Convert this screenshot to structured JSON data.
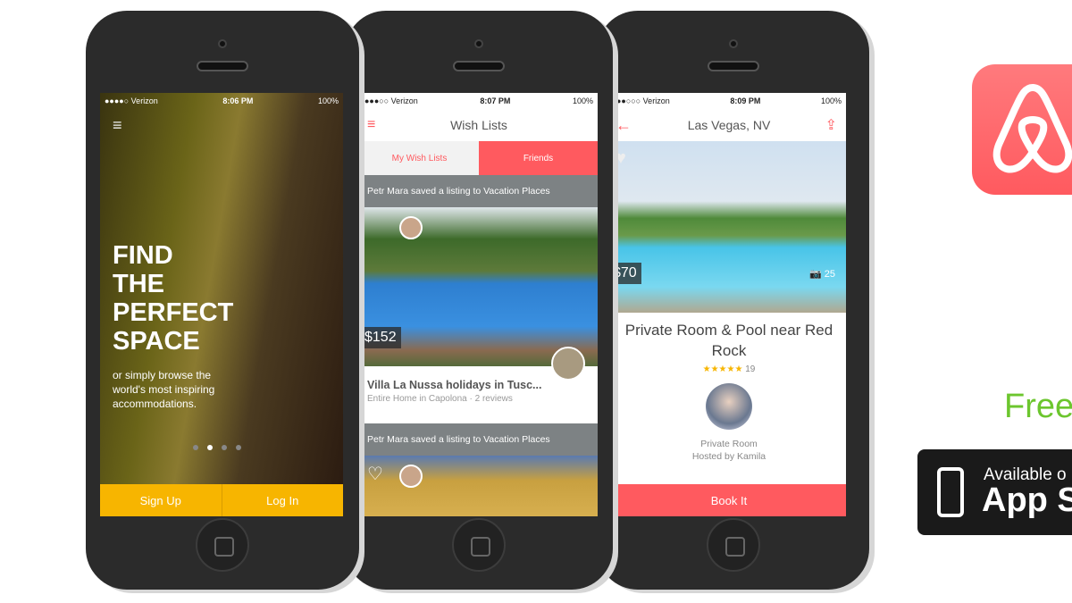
{
  "phone1": {
    "status": {
      "carrier": "●●●●○ Verizon",
      "time": "8:06 PM",
      "battery": "100%"
    },
    "headline": [
      "FIND",
      "THE",
      "PERFECT",
      "SPACE"
    ],
    "subtext": "or simply browse the world's most inspiring accommodations.",
    "sign_up": "Sign Up",
    "log_in": "Log In",
    "carousel_active": 2,
    "carousel_count": 4
  },
  "phone2": {
    "status": {
      "carrier": "●●●○○ Verizon",
      "time": "8:07 PM",
      "battery": "100%"
    },
    "title": "Wish Lists",
    "tabs": [
      "My Wish Lists",
      "Friends"
    ],
    "active_tab": "Friends",
    "feed": [
      {
        "activity": "Petr Mara saved a listing to Vacation Places",
        "price": "$152",
        "listing_title": "Villa La Nussa holidays in Tusc...",
        "listing_sub": "Entire Home in Capolona · 2 reviews"
      },
      {
        "activity": "Petr Mara saved a listing to Vacation Places"
      }
    ]
  },
  "phone3": {
    "status": {
      "carrier": "●●○○○ Verizon",
      "time": "8:09 PM",
      "battery": "100%"
    },
    "title": "Las Vegas, NV",
    "price": "$70",
    "photo_count": "25",
    "listing_title": "Private Room & Pool near Red Rock",
    "stars": "★★★★★",
    "review_count": "19",
    "room_type": "Private Room",
    "host": "Hosted by Kamila",
    "book": "Book It"
  },
  "promo": {
    "free": "Free",
    "badge_line1": "Available o",
    "badge_line2": "App S"
  },
  "colors": {
    "brand": "#ff5a5f",
    "yellow": "#f7b500",
    "green": "#6cc62e"
  }
}
